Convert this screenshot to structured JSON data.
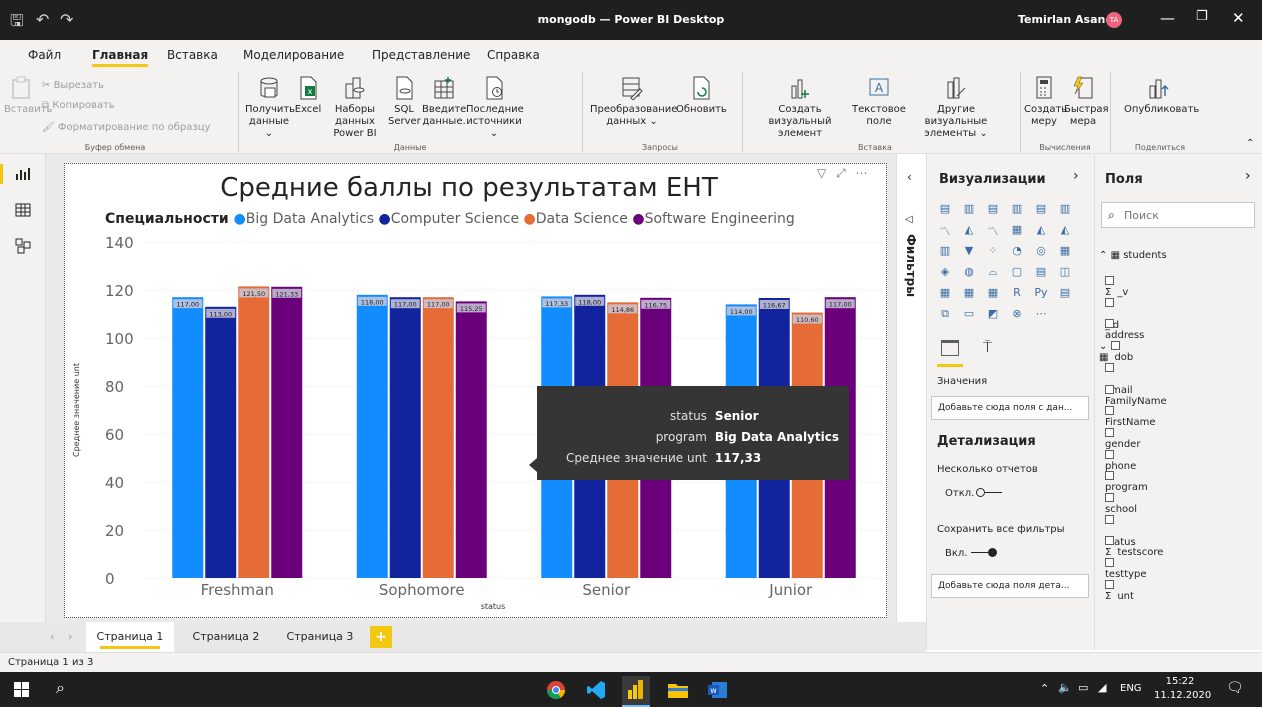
{
  "window": {
    "title": "mongodb — Power BI Desktop",
    "user": "Temirlan Asanov",
    "user_initials": "TA"
  },
  "menu": [
    "Файл",
    "Главная",
    "Вставка",
    "Моделирование",
    "Представление",
    "Справка"
  ],
  "menu_active": "Главная",
  "ribbon": {
    "paste": "Вставить",
    "cut": "Вырезать",
    "copy": "Копировать",
    "format_painter": "Форматирование по образцу",
    "group_clipboard": "Буфер обмена",
    "get_data_1": "Получить",
    "get_data_2": "данные",
    "excel": "Excel",
    "datasets_1": "Наборы данных",
    "datasets_2": "Power BI",
    "sql_1": "SQL",
    "sql_2": "Server",
    "enter_data_1": "Введите",
    "enter_data_2": "данные.",
    "recent_1": "Последние",
    "recent_2": "источники",
    "group_data": "Данные",
    "transform_1": "Преобразование",
    "transform_2": "данных",
    "refresh": "Обновить",
    "group_queries": "Запросы",
    "new_visual_1": "Создать визуальный",
    "new_visual_2": "элемент",
    "textbox_1": "Текстовое",
    "textbox_2": "поле",
    "more_visuals_1": "Другие визуальные",
    "more_visuals_2": "элементы",
    "group_insert": "Вставка",
    "new_measure_1": "Создать",
    "new_measure_2": "меру",
    "quick_measure_1": "Быстрая",
    "quick_measure_2": "мера",
    "group_calc": "Вычисления",
    "publish": "Опубликовать",
    "group_share": "Поделиться"
  },
  "filters_label": "Фильтры",
  "viz_pane": {
    "title": "Визуализации",
    "values_label": "Значения",
    "values_placeholder": "Добавьте сюда поля с дан...",
    "drill_title": "Детализация",
    "cross_report": "Несколько отчетов",
    "cross_report_state": "Откл.",
    "keep_filters": "Сохранить все фильтры",
    "keep_filters_state": "Вкл.",
    "drill_placeholder": "Добавьте сюда поля дета..."
  },
  "fields_pane": {
    "title": "Поля",
    "search_placeholder": "Поиск",
    "table": "students",
    "fields": [
      {
        "name": "_v",
        "sigma": true
      },
      {
        "name": "_id",
        "sigma": false
      },
      {
        "name": "address",
        "sigma": false
      },
      {
        "name": "dob",
        "sigma": false,
        "table_icon": true,
        "expand": true
      },
      {
        "name": "email",
        "sigma": false
      },
      {
        "name": "FamilyName",
        "sigma": false
      },
      {
        "name": "FirstName",
        "sigma": false
      },
      {
        "name": "gender",
        "sigma": false
      },
      {
        "name": "phone",
        "sigma": false
      },
      {
        "name": "program",
        "sigma": false
      },
      {
        "name": "school",
        "sigma": false
      },
      {
        "name": "status",
        "sigma": false
      },
      {
        "name": "testscore",
        "sigma": true
      },
      {
        "name": "testtype",
        "sigma": false
      },
      {
        "name": "unt",
        "sigma": true
      }
    ]
  },
  "pages": [
    "Страница 1",
    "Страница 2",
    "Страница 3"
  ],
  "add_page": "+",
  "status_text": "Страница 1 из 3",
  "tooltip": {
    "rows": [
      {
        "label": "status",
        "value": "Senior"
      },
      {
        "label": "program",
        "value": "Big Data Analytics"
      },
      {
        "label": "Среднее значение unt",
        "value": "117,33"
      }
    ]
  },
  "taskbar": {
    "lang": "ENG",
    "time": "15:22",
    "date": "11.12.2020"
  },
  "colors": {
    "s1": "#118dff",
    "s2": "#12239e",
    "s3": "#e66c37",
    "s4": "#6b007b",
    "accent": "#f2c811"
  },
  "chart_data": {
    "type": "bar",
    "title": "Средние баллы по результатам ЕНТ",
    "legend_title": "Специальности",
    "legend_position": "top",
    "xlabel": "status",
    "ylabel": "Среднее значение unt",
    "ylim": [
      0,
      140
    ],
    "yticks": [
      0,
      20,
      40,
      60,
      80,
      100,
      120,
      140
    ],
    "grid": true,
    "categories": [
      "Freshman",
      "Sophomore",
      "Senior",
      "Junior"
    ],
    "series": [
      {
        "name": "Big Data Analytics",
        "values": [
          117.0,
          118.0,
          117.33,
          114.0
        ],
        "labels": [
          "117,00",
          "118,00",
          "117,33",
          "114,00"
        ]
      },
      {
        "name": "Computer Science",
        "values": [
          113.0,
          117.0,
          118.0,
          116.67
        ],
        "labels": [
          "113,00",
          "117,00",
          "118,00",
          "116,67"
        ]
      },
      {
        "name": "Data Science",
        "values": [
          121.5,
          117.0,
          114.86,
          110.6
        ],
        "labels": [
          "121,50",
          "117,00",
          "114,86",
          "110,60"
        ]
      },
      {
        "name": "Software Engineering",
        "values": [
          121.33,
          115.25,
          116.75,
          117.0
        ],
        "labels": [
          "121,33",
          "115,25",
          "116,75",
          "117,00"
        ]
      }
    ]
  }
}
